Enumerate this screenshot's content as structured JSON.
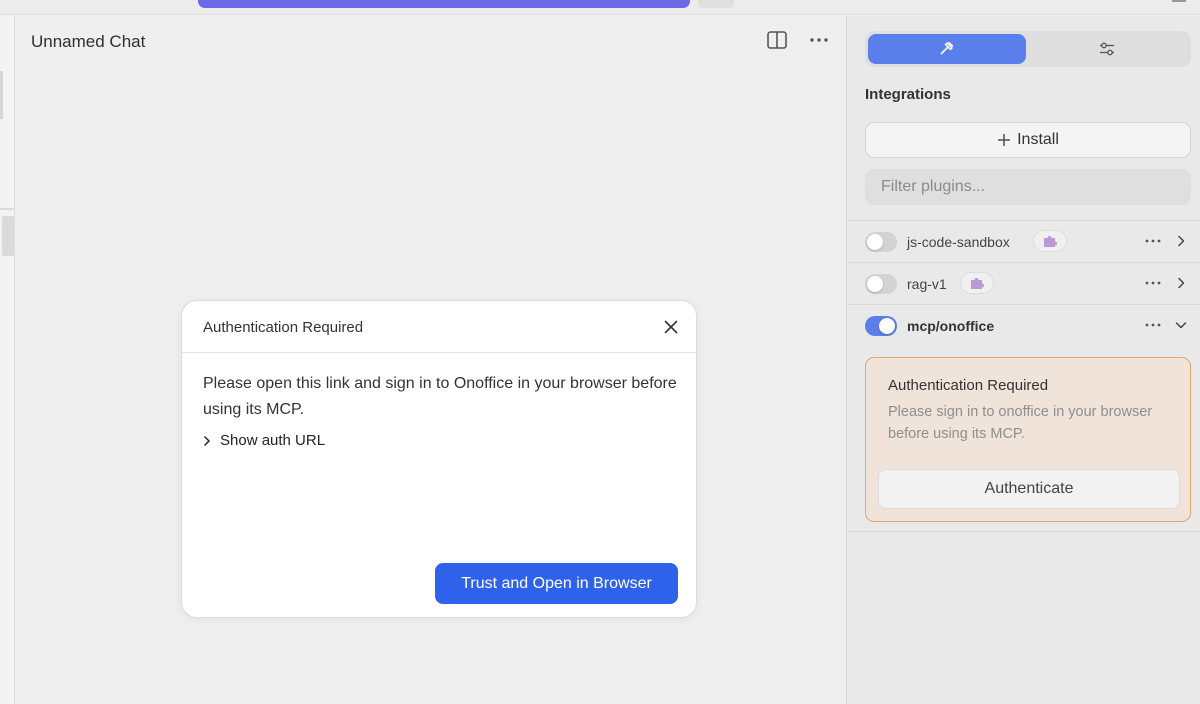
{
  "chat": {
    "title": "Unnamed Chat",
    "split_icon": "split-view-icon",
    "more_icon": "more-horizontal-icon"
  },
  "panel": {
    "tabs": [
      {
        "icon": "hammer-icon",
        "active": true
      },
      {
        "icon": "sliders-icon",
        "active": false
      }
    ],
    "heading": "Integrations",
    "install_label": "Install",
    "filter_placeholder": "Filter plugins...",
    "plugins": [
      {
        "name": "js-code-sandbox",
        "enabled": false,
        "badge_icon": "puzzle-icon",
        "expanded": false
      },
      {
        "name": "rag-v1",
        "enabled": false,
        "badge_icon": "puzzle-icon",
        "expanded": false
      },
      {
        "name": "mcp/onoffice",
        "enabled": true,
        "expanded": true
      }
    ],
    "auth_card": {
      "title": "Authentication Required",
      "description": "Please sign in to onoffice in your browser before using its MCP.",
      "button_label": "Authenticate"
    }
  },
  "modal": {
    "title": "Authentication Required",
    "message": "Please open this link and sign in to Onoffice in your browser before using its MCP.",
    "show_url_label": "Show auth URL",
    "primary_label": "Trust and Open in Browser"
  },
  "colors": {
    "accent": "#5b7fea",
    "primary_button": "#2f62ea",
    "top_bar": "#6d68e6",
    "warning_border": "#e6a56f",
    "warning_bg": "#f0e4da"
  }
}
